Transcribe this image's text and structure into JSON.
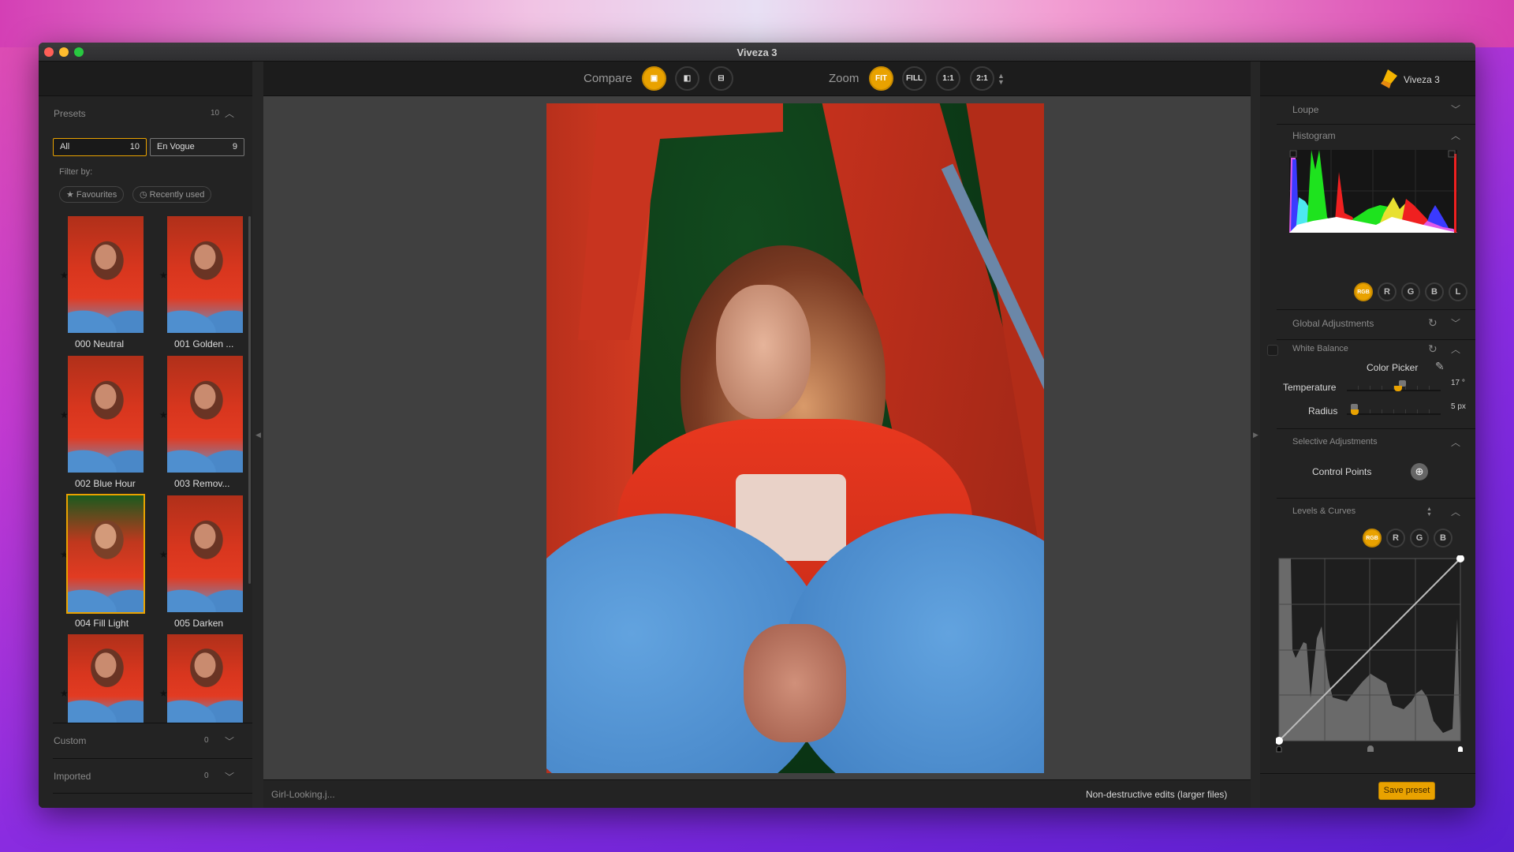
{
  "window": {
    "title": "Viveza 3"
  },
  "presets": {
    "header": "Presets",
    "count": "10",
    "tabs": [
      {
        "label": "All",
        "count": "10"
      },
      {
        "label": "En Vogue",
        "count": "9"
      }
    ],
    "filter_label": "Filter by:",
    "filters": [
      "★ Favourites",
      "◷ Recently used"
    ],
    "items": [
      {
        "name": "000 Neutral"
      },
      {
        "name": "001 Golden ..."
      },
      {
        "name": "002 Blue Hour"
      },
      {
        "name": "003 Remov..."
      },
      {
        "name": "004 Fill Light",
        "selected": true
      },
      {
        "name": "005 Darken"
      },
      {
        "name": ""
      },
      {
        "name": ""
      }
    ],
    "custom": {
      "label": "Custom",
      "count": "0"
    },
    "imported": {
      "label": "Imported",
      "count": "0"
    }
  },
  "toolbar": {
    "compare_label": "Compare",
    "compare_modes": [
      {
        "icon": "single-view-icon",
        "active": true
      },
      {
        "icon": "split-view-icon"
      },
      {
        "icon": "side-by-side-icon"
      }
    ],
    "zoom_label": "Zoom",
    "zoom_options": [
      {
        "label": "FIT",
        "active": true
      },
      {
        "label": "FILL"
      },
      {
        "label": "1:1"
      },
      {
        "label": "2:1"
      }
    ]
  },
  "status": {
    "filename": "Girl-Looking.j...",
    "nondestructive_label": "Non-destructive edits (larger files)",
    "nondestructive_checked": false
  },
  "right": {
    "app_name": "Viveza 3",
    "loupe": "Loupe",
    "histogram": {
      "label": "Histogram",
      "channels": [
        "RGB",
        "R",
        "G",
        "B",
        "L"
      ],
      "active": "RGB"
    },
    "global": "Global Adjustments",
    "white_balance": {
      "label": "White Balance",
      "color_picker": "Color Picker",
      "temperature": {
        "label": "Temperature",
        "value": "17 °",
        "fraction": 0.55
      },
      "radius": {
        "label": "Radius",
        "value": "5 px",
        "fraction": 0.05
      }
    },
    "selective": {
      "label": "Selective Adjustments",
      "control_points": "Control Points"
    },
    "levels": {
      "label": "Levels & Curves",
      "channels": [
        "RGB",
        "R",
        "G",
        "B"
      ],
      "active": "RGB"
    },
    "save_preset": "Save preset"
  },
  "colors": {
    "accent": "#e9a200"
  }
}
